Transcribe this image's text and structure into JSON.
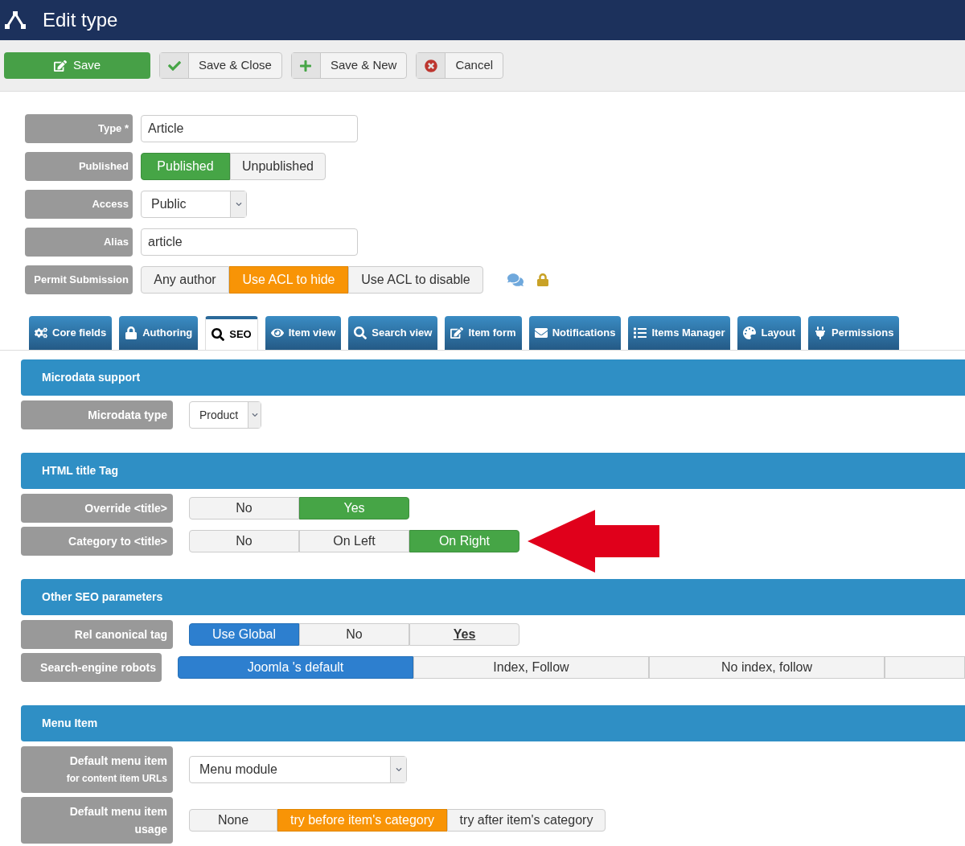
{
  "header": {
    "title": "Edit type"
  },
  "toolbar": [
    {
      "label": "Save",
      "kind": "primary"
    },
    {
      "label": "Save & Close",
      "kind": "normal"
    },
    {
      "label": "Save & New",
      "kind": "normal"
    },
    {
      "label": "Cancel",
      "kind": "normal"
    }
  ],
  "form": [
    {
      "label": "Type *",
      "kind": "text",
      "value": "Article"
    },
    {
      "label": "Published",
      "kind": "radio",
      "options": [
        {
          "label": "Published",
          "selected": true
        },
        {
          "label": "Unpublished",
          "selected": false
        }
      ]
    },
    {
      "label": "Access",
      "kind": "select",
      "value": "Public"
    },
    {
      "label": "Alias",
      "kind": "text",
      "value": "article"
    },
    {
      "label": "Permit Submission",
      "kind": "radio",
      "options": [
        {
          "label": "Any author",
          "selected": false
        },
        {
          "label": "Use ACL to hide",
          "selected": true
        },
        {
          "label": "Use ACL to disable",
          "selected": false
        }
      ]
    }
  ],
  "tabs": [
    {
      "label": "Core fields",
      "selected": false
    },
    {
      "label": "Authoring",
      "selected": false
    },
    {
      "label": "SEO",
      "selected": true
    },
    {
      "label": "Item view",
      "selected": false
    },
    {
      "label": "Search view",
      "selected": false
    },
    {
      "label": "Item form",
      "selected": false
    },
    {
      "label": "Notifications",
      "selected": false
    },
    {
      "label": "Items Manager",
      "selected": false
    },
    {
      "label": "Layout",
      "selected": false
    },
    {
      "label": "Permissions",
      "selected": false
    }
  ],
  "sections": [
    {
      "title": "Microdata support",
      "rows": [
        {
          "label": "Microdata type",
          "kind": "select",
          "value": "Product"
        }
      ]
    },
    {
      "title": "HTML title Tag",
      "rows": [
        {
          "label": "Override <title>",
          "kind": "radio",
          "options": [
            {
              "label": "No",
              "selected": false
            },
            {
              "label": "Yes",
              "selected": true
            }
          ]
        },
        {
          "label": "Category to <title>",
          "kind": "radio",
          "options": [
            {
              "label": "No",
              "selected": false
            },
            {
              "label": "On Left",
              "selected": false
            },
            {
              "label": "On Right",
              "selected": true
            }
          ]
        }
      ]
    },
    {
      "title": "Other SEO parameters",
      "rows": [
        {
          "label": "Rel canonical tag",
          "kind": "radio",
          "options": [
            {
              "label": "Use Global",
              "selected": true
            },
            {
              "label": "No",
              "selected": false
            },
            {
              "label": "Yes",
              "selected": false,
              "emphasized": true
            }
          ]
        },
        {
          "label": "Search-engine robots",
          "kind": "radio",
          "options": [
            {
              "label": "Joomla 's default",
              "selected": true
            },
            {
              "label": "Index, Follow",
              "selected": false
            },
            {
              "label": "No index, follow",
              "selected": false
            }
          ]
        }
      ]
    },
    {
      "title": "Menu Item",
      "rows": [
        {
          "label": "Default menu item",
          "sublabel": "for content item URLs",
          "kind": "select",
          "value": "Menu module"
        },
        {
          "label": "Default menu item usage",
          "kind": "radio",
          "options": [
            {
              "label": "None",
              "selected": false
            },
            {
              "label": "try before item's category",
              "selected": true
            },
            {
              "label": "try after item's category",
              "selected": false
            }
          ]
        }
      ]
    }
  ]
}
